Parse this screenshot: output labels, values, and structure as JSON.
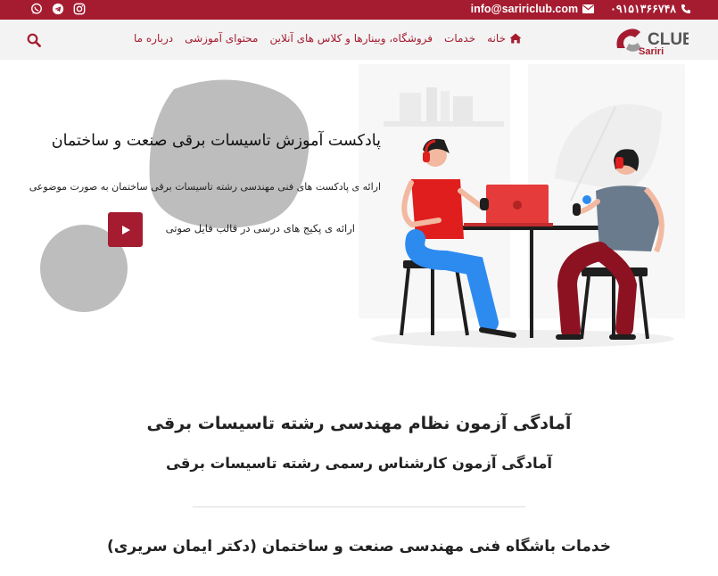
{
  "topbar": {
    "phone": "۰۹۱۵۱۳۶۶۷۴۸",
    "email": "info@saririclub.com",
    "social": [
      "whatsapp-icon",
      "telegram-icon",
      "instagram-icon"
    ]
  },
  "logo": {
    "word_top": "CLUB",
    "word_bottom": "Sariri"
  },
  "nav": {
    "items": [
      {
        "label": "خانه",
        "icon": "home-icon"
      },
      {
        "label": "خدمات"
      },
      {
        "label": "فروشگاه، وبینارها و کلاس های آنلاین"
      },
      {
        "label": "محتوای آموزشی"
      },
      {
        "label": "درباره ما"
      }
    ]
  },
  "hero": {
    "title": "پادکست آموزش تاسیسات برقی صنعت و ساختمان",
    "description": "ارائه ی پادکست های فنی مهندسی رشته تاسیسات برقی ساختمان به صورت موضوعی",
    "audio_text": "ارائه ی پکیج های درسی در قالب فایل صوتی"
  },
  "sections": {
    "heading1": "آمادگی آزمون نظام مهندسی رشته تاسیسات برقی",
    "heading2": "آمادگی آزمون کارشناس رسمی رشته تاسیسات برقی",
    "heading3": "خدمات باشگاه فنی مهندسی صنعت و ساختمان (دکتر ایمان سریری)"
  },
  "colors": {
    "brand": "#a51c30",
    "nav_bg": "#f3f3f3",
    "blob": "#bdbdbd"
  }
}
